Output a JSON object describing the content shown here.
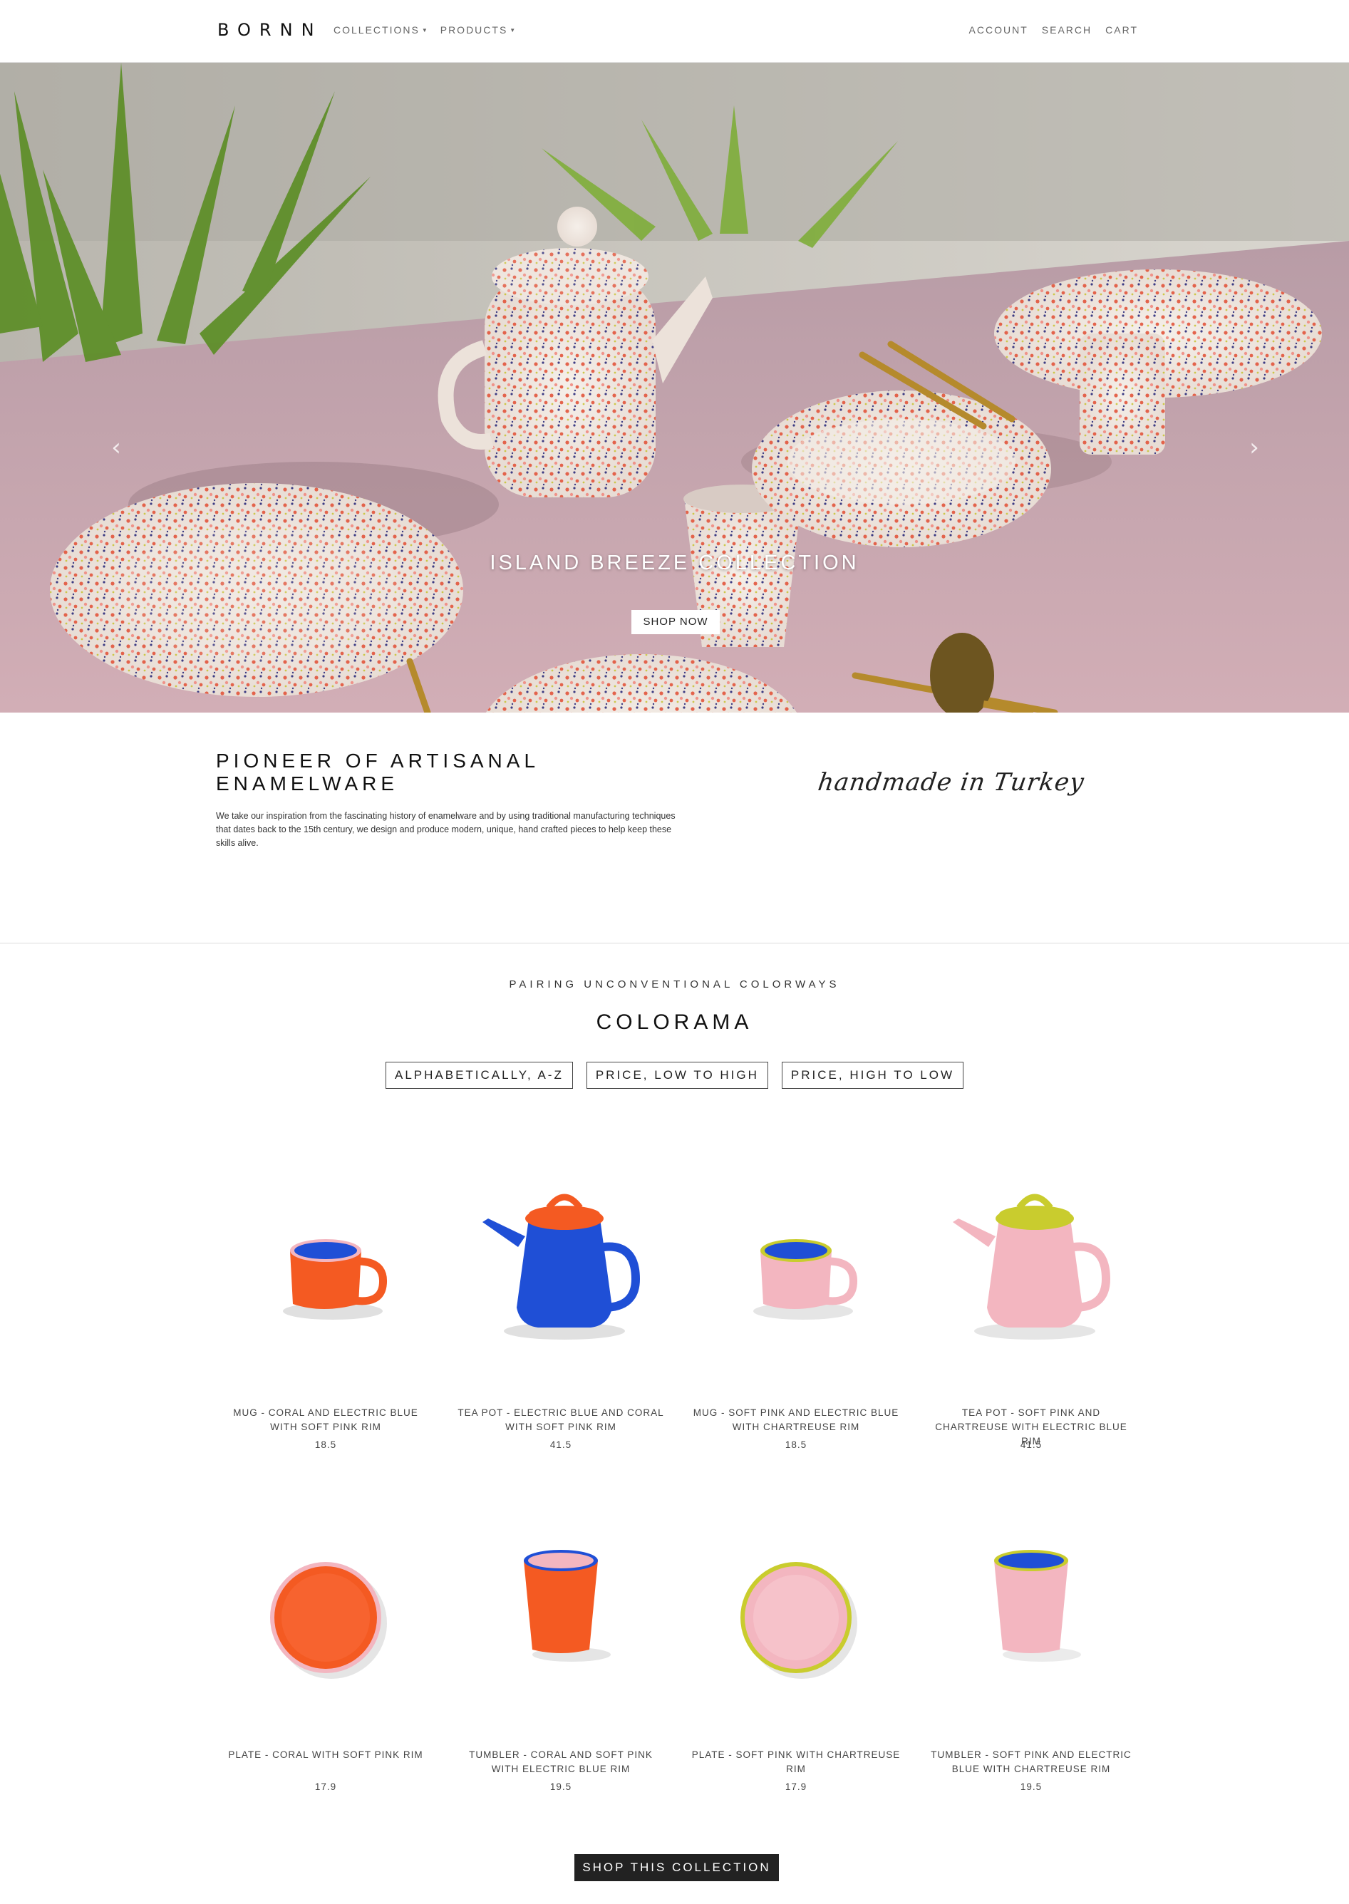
{
  "header": {
    "logo": "BORNN",
    "nav_left": [
      {
        "label": "COLLECTIONS"
      },
      {
        "label": "PRODUCTS"
      }
    ],
    "nav_right": [
      {
        "label": "ACCOUNT"
      },
      {
        "label": "SEARCH"
      },
      {
        "label": "CART"
      }
    ]
  },
  "hero": {
    "title": "ISLAND BREEZE COLLECTION",
    "button": "SHOP NOW",
    "prev_icon": "chevron-left-icon",
    "next_icon": "chevron-right-icon"
  },
  "intro": {
    "title": "PIONEER OF ARTISANAL ENAMELWARE",
    "text": "We take our inspiration from the fascinating history of enamelware and by using traditional manufacturing techniques that dates back to the 15th century, we design and produce modern, unique, hand crafted pieces to help keep these skills alive.",
    "signature": "handmade in Turkey"
  },
  "collection": {
    "kicker": "PAIRING UNCONVENTIONAL COLORWAYS",
    "title": "COLORAMA",
    "sort_options": [
      "ALPHABETICALLY, A-Z",
      "PRICE, LOW TO HIGH",
      "PRICE, HIGH TO LOW"
    ],
    "products": [
      {
        "name": "MUG - CORAL AND ELECTRIC BLUE WITH SOFT PINK RIM",
        "price": "18.5"
      },
      {
        "name": "TEA POT - ELECTRIC BLUE AND CORAL WITH SOFT PINK RIM",
        "price": "41.5"
      },
      {
        "name": "MUG - SOFT PINK AND ELECTRIC BLUE WITH CHARTREUSE RIM",
        "price": "18.5"
      },
      {
        "name": "TEA POT - SOFT PINK AND CHARTREUSE WITH ELECTRIC BLUE RIM",
        "price": "41.5"
      },
      {
        "name": "PLATE - CORAL WITH SOFT PINK RIM",
        "price": "17.9"
      },
      {
        "name": "TUMBLER - CORAL AND SOFT PINK WITH ELECTRIC BLUE RIM",
        "price": "19.5"
      },
      {
        "name": "PLATE - SOFT PINK WITH CHARTREUSE RIM",
        "price": "17.9"
      },
      {
        "name": "TUMBLER - SOFT PINK AND ELECTRIC BLUE WITH CHARTREUSE RIM",
        "price": "19.5"
      }
    ],
    "cta": "SHOP THIS COLLECTION"
  },
  "colors": {
    "coral": "#f45a22",
    "electric_blue": "#1f4fd6",
    "soft_pink": "#f3b6c0",
    "chartreuse": "#c9cc2e"
  }
}
